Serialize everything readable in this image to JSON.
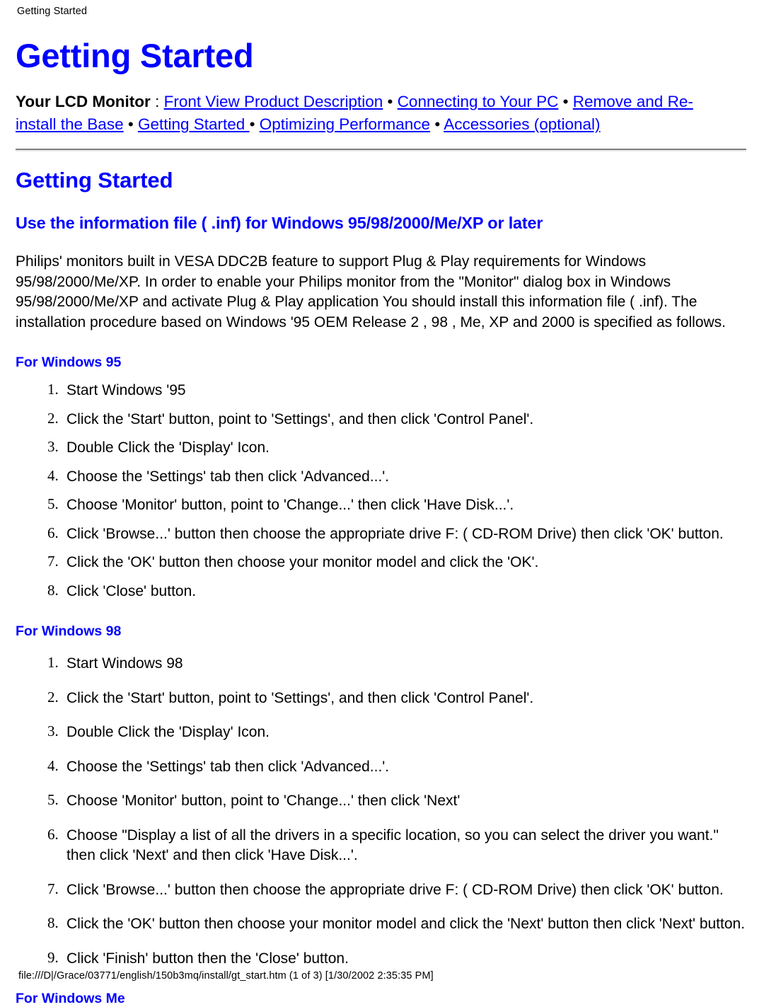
{
  "print_header": "Getting Started",
  "doc": {
    "title": "Getting Started",
    "nav": {
      "lead": "Your LCD Monitor",
      "colon": " : ",
      "separator": " • ",
      "links": [
        "Front View Product Description",
        "Connecting to Your PC",
        "Remove and Re-install the Base",
        "Getting Started ",
        "Optimizing Performance",
        "Accessories (optional)"
      ]
    },
    "section_title": "Getting Started",
    "sub_title": "Use the information file ( .inf) for Windows 95/98/2000/Me/XP or later",
    "intro_paragraph": "Philips' monitors built in VESA DDC2B feature to support Plug & Play requirements for Windows 95/98/2000/Me/XP. In order to enable your Philips monitor from the \"Monitor\" dialog box in Windows 95/98/2000/Me/XP and activate Plug & Play application You should install this information file ( .inf). The installation procedure based on Windows '95 OEM Release 2 , 98 , Me, XP and 2000 is specified as follows.",
    "groups": [
      {
        "heading": "For Windows 95",
        "steps": [
          "Start Windows '95",
          "Click the 'Start' button, point to 'Settings', and then click 'Control Panel'.",
          "Double Click the 'Display' Icon.",
          "Choose the 'Settings' tab then click 'Advanced...'.",
          "Choose 'Monitor' button, point to 'Change...' then click 'Have Disk...'.",
          "Click 'Browse...' button then choose the appropriate drive F: ( CD-ROM Drive) then click 'OK' button.",
          "Click the 'OK' button then choose your monitor model and click the 'OK'.",
          "Click 'Close' button."
        ]
      },
      {
        "heading": "For Windows 98",
        "steps": [
          "Start Windows 98",
          "Click the 'Start' button, point to 'Settings', and then click 'Control Panel'.",
          "Double Click the 'Display' Icon.",
          "Choose the 'Settings' tab then click 'Advanced...'.",
          "Choose 'Monitor' button, point to 'Change...' then click 'Next'",
          "Choose \"Display a list of all the drivers in a specific location, so you can select the driver you want.\" then click 'Next' and then click 'Have Disk...'.",
          "Click 'Browse...' button then choose the appropriate drive F: ( CD-ROM Drive) then click 'OK' button.",
          "Click the 'OK' button then choose your monitor model and click the 'Next' button then click 'Next' button.",
          "Click 'Finish' button then the 'Close' button."
        ]
      },
      {
        "heading": "For Windows Me",
        "steps": []
      }
    ]
  },
  "print_footer": "file:///D|/Grace/03771/english/150b3mq/install/gt_start.htm (1 of 3) [1/30/2002 2:35:35 PM]",
  "colors": {
    "link": "#0000ff",
    "heading": "#0000ff",
    "text": "#000000",
    "rule_dark": "#808080",
    "rule_light": "#e8e8e8"
  }
}
